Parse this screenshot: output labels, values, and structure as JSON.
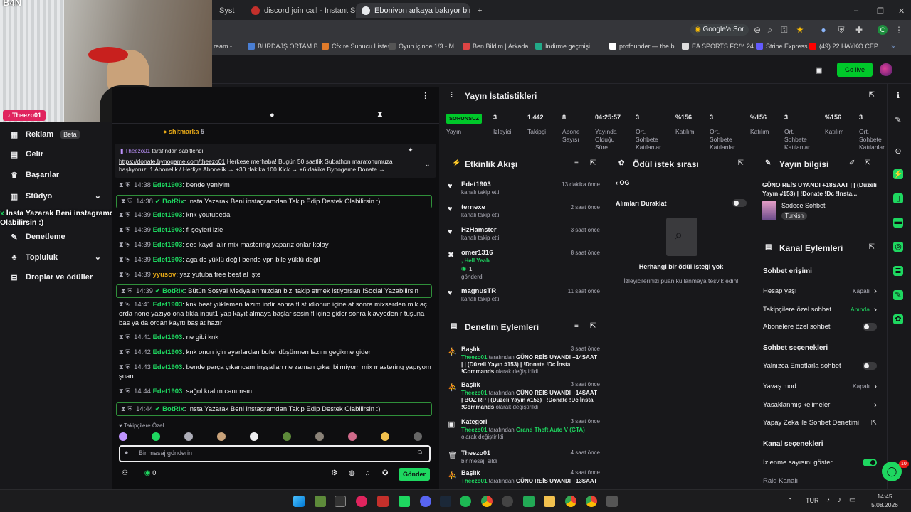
{
  "browser": {
    "tabs": [
      {
        "title": "Syst",
        "fav": "#6441a5"
      },
      {
        "title": "discord join call - Instant Sound",
        "fav": "#c4302b"
      },
      {
        "title": "Ebonivon arkaya bakıyor birand",
        "fav": "#e8eaed"
      }
    ],
    "address_actions": {
      "google_lens": "Google'a Sor"
    },
    "bookmarks": [
      {
        "label": "ream -...",
        "color": "#888"
      },
      {
        "label": "BURDAJŞ ORTAM B...",
        "color": "#4a7fd4"
      },
      {
        "label": "Cfx.re Sunucu Listesi",
        "color": "#e07b2a"
      },
      {
        "label": "Oyun içinde 1/3 - M...",
        "color": "#333"
      },
      {
        "label": "Ben Bildim | Arkada...",
        "color": "#d44"
      },
      {
        "label": "İndirme geçmişi",
        "color": "#2a8"
      },
      {
        "label": "profounder — the b...",
        "color": "#fff"
      },
      {
        "label": "EA SPORTS FC™ 24...",
        "color": "#ddd"
      },
      {
        "label": "Stripe Express",
        "color": "#635bff"
      },
      {
        "label": "(49) 22 HAYKO CEP...",
        "color": "#f00"
      }
    ]
  },
  "header": {
    "go_live": "Go live"
  },
  "webcam": {
    "overlay_top": "B4N",
    "badge": "Theezo01"
  },
  "sidebar": {
    "items": [
      {
        "label": "Reklam",
        "badge": "Beta"
      },
      {
        "label": "Gelir"
      },
      {
        "label": "Başarılar"
      },
      {
        "label": "Stüdyo"
      },
      {
        "label": "Denetleme"
      },
      {
        "label": "Topluluk"
      },
      {
        "label": "Droplar ve ödüller"
      }
    ]
  },
  "overlay_alert": "İnsta Yazarak Beni instagramdan Takip Edip Destek Olabilirsin :)",
  "chat": {
    "top_user": "shitmarka",
    "top_count": "5",
    "pinned_by": "Theezo01",
    "pinned_label": "tarafından sabitlendi",
    "pinned_link": "https://donate.bynogame.com/theezo01",
    "pinned_text": " Herkese merhaba! Bugün 50 saatlik Subathon maratonumuza başlıyoruz. 1 Abonelik / Hediye Abonelik → +30 dakika 100 Kick → +6 dakika Bynogame Donate →...",
    "messages": [
      {
        "time": "14:38",
        "user": "Edet1903",
        "color": "#1ed760",
        "text": "bende yeniyim",
        "bot": false
      },
      {
        "time": "14:38",
        "user": "BotRix",
        "color": "#1ed760",
        "text": "İnsta Yazarak Beni instagramdan Takip Edip Destek Olabilirsin :)",
        "bot": true
      },
      {
        "time": "14:39",
        "user": "Edet1903",
        "color": "#1ed760",
        "text": "knk youtubeda",
        "bot": false
      },
      {
        "time": "14:39",
        "user": "Edet1903",
        "color": "#1ed760",
        "text": "fl şeyleri izle",
        "bot": false
      },
      {
        "time": "14:39",
        "user": "Edet1903",
        "color": "#1ed760",
        "text": "ses kaydı alır mix mastering yaparız onlar kolay",
        "bot": false
      },
      {
        "time": "14:39",
        "user": "Edet1903",
        "color": "#1ed760",
        "text": "aga dc yüklü değil bende vpn bile yüklü değil",
        "bot": false
      },
      {
        "time": "14:39",
        "user": "yyusov",
        "color": "#e6a817",
        "text": "yaz yutuba free beat al işte",
        "bot": false
      },
      {
        "time": "14:39",
        "user": "BotRix",
        "color": "#1ed760",
        "text": "Bütün Sosyal Medyalarımızdan bizi takip etmek istiyorsan !Social Yazabilirsin",
        "bot": true
      },
      {
        "time": "14:41",
        "user": "Edet1903",
        "color": "#1ed760",
        "text": "knk beat yüklemen lazım indir sonra fl studionun içine at sonra mixserden mik aç orda none yazıyo ona tıkla input1 yap kayıt almaya başlar sesin fl içine gider sonra klavyeden r tuşuna bas ya da ordan kayıtı başlat hazır",
        "bot": false
      },
      {
        "time": "14:41",
        "user": "Edet1903",
        "color": "#1ed760",
        "text": "ne gibi knk",
        "bot": false
      },
      {
        "time": "14:42",
        "user": "Edet1903",
        "color": "#1ed760",
        "text": "knk onun için ayarlardan bufer düşürmen lazım geçikme gider",
        "bot": false
      },
      {
        "time": "14:43",
        "user": "Edet1903",
        "color": "#1ed760",
        "text": "bende parça çıkarıcam inşşallah ne zaman çıkar bilmiyom mix mastering yapıyom şuan",
        "bot": false
      },
      {
        "time": "14:44",
        "user": "Edet1903",
        "color": "#1ed760",
        "text": "sağol kralım canımsın",
        "bot": false
      },
      {
        "time": "14:44",
        "user": "BotRix",
        "color": "#1ed760",
        "text": "İnsta Yazarak Beni instagramdan Takip Edip Destek Olabilirsin :)",
        "bot": true
      }
    ],
    "followers_only": "Takipçilere Özel",
    "input_placeholder": "Bir mesaj gönderin",
    "points": "0",
    "send_label": "Gönder"
  },
  "stats": {
    "title": "Yayın İstatistikleri",
    "live_badge": "SORUNSUZ",
    "items": [
      {
        "value": "",
        "label": "Yayın"
      },
      {
        "value": "3",
        "label": "İzleyici"
      },
      {
        "value": "1.442",
        "label": "Takipçi"
      },
      {
        "value": "8",
        "label": "Abone Sayısı"
      },
      {
        "value": "04:25:57",
        "label": "Yayında Olduğu Süre"
      },
      {
        "value": "3",
        "label": "Ort. Sohbete Katılanlar"
      },
      {
        "value": "%156",
        "label": "Katılım"
      },
      {
        "value": "3",
        "label": "Ort. Sohbete Katılanlar"
      },
      {
        "value": "%156",
        "label": "Katılım"
      },
      {
        "value": "3",
        "label": "Ort. Sohbete Katılanlar"
      },
      {
        "value": "%156",
        "label": "Katılım"
      },
      {
        "value": "3",
        "label": "Ort. Sohbete Katılanlar"
      }
    ]
  },
  "activity": {
    "title": "Etkinlik Akışı",
    "items": [
      {
        "name": "Edet1903",
        "sub": "kanalı takip etti",
        "time": "13 dakika önce",
        "icon": "heart"
      },
      {
        "name": "ternexe",
        "sub": "kanalı takip etti",
        "time": "2 saat önce",
        "icon": "heart"
      },
      {
        "name": "HzHamster",
        "sub": "kanalı takip etti",
        "time": "3 saat önce",
        "icon": "heart"
      },
      {
        "name": "omer1316",
        "sub": ", Hell Yeah",
        "sub2": "1",
        "sub3": "gönderdi",
        "time": "8 saat önce",
        "icon": "kick"
      },
      {
        "name": "magnusTR",
        "sub": "kanalı takip etti",
        "time": "11 saat önce",
        "icon": "heart"
      }
    ]
  },
  "rewards": {
    "title": "Ödül istek sırası",
    "back": "OG",
    "pause_label": "Alımları Duraklat",
    "empty_title": "Herhangi bir ödül isteği yok",
    "empty_sub": "İzleyicilerinizi puan kullanmaya teşvik edin!"
  },
  "stream_info": {
    "title": "Yayın bilgisi",
    "stream_title": "GÜNO REİS UYANDI +18SAAT | | (Düzeli Yayın #153) | !Donate !Dc !İnsta...",
    "category": "Sadece Sohbet",
    "language": "Turkish"
  },
  "mod": {
    "title": "Denetim Eylemleri",
    "items": [
      {
        "title": "Başlık",
        "time": "3 saat önce",
        "actor": "Theezo01",
        "mid": " tarafından ",
        "text": "GÜNO REİS UYANDI +14SAAT | | (Düzeli Yayın #153) | !Donate !Dc İnsta !Commands",
        "tail": " olarak değiştirildi"
      },
      {
        "title": "Başlık",
        "time": "3 saat önce",
        "actor": "Theezo01",
        "mid": " tarafından ",
        "text": "GÜNO REİS UYANDI +14SAAT | BOZ RP | (Düzeli Yayın #153) | !Donate !Dc İnsta !Commands",
        "tail": " olarak değiştirildi"
      },
      {
        "title": "Kategori",
        "time": "3 saat önce",
        "actor": "Theezo01",
        "mid": " tarafından ",
        "text": "Grand Theft Auto V (GTA)",
        "tail": " olarak değiştirildi"
      },
      {
        "title": "Theezo01",
        "time": "4 saat önce",
        "actor": "",
        "mid": "",
        "text": "",
        "tail": "bir mesajı sildi"
      },
      {
        "title": "Başlık",
        "time": "4 saat önce",
        "actor": "Theezo01",
        "mid": " tarafından ",
        "text": "GÜNO REİS UYANDI +13SAAT",
        "tail": ""
      }
    ]
  },
  "channel": {
    "title": "Kanal Eylemleri",
    "sec1": "Sohbet erişimi",
    "rows1": [
      {
        "label": "Hesap yaşı",
        "value": "Kapalı",
        "kind": "chev"
      },
      {
        "label": "Takipçilere özel sohbet",
        "value": "Anında",
        "kind": "chev",
        "accent": true
      },
      {
        "label": "Abonelere özel sohbet",
        "value": "",
        "kind": "toggle"
      }
    ],
    "sec2": "Sohbet seçenekleri",
    "rows2": [
      {
        "label": "Yalnızca Emotlarla sohbet",
        "value": "",
        "kind": "toggle"
      },
      {
        "label": "Yavaş mod",
        "value": "Kapalı",
        "kind": "chev"
      },
      {
        "label": "Yasaklanmış kelimeler",
        "value": "",
        "kind": "chev"
      },
      {
        "label": "Yapay Zeka ile Sohbet Denetimi",
        "value": "",
        "kind": "ext"
      }
    ],
    "sec3": "Kanal seçenekleri",
    "rows3": [
      {
        "label": "İzlenme sayısını göster",
        "value": "",
        "kind": "toggle-on"
      },
      {
        "label": "Raid Kanalı",
        "value": "",
        "kind": "none"
      }
    ]
  },
  "fab_badge": "10",
  "taskbar": {
    "lang": "TUR",
    "time": "14:45",
    "date": "5.08.2026"
  }
}
